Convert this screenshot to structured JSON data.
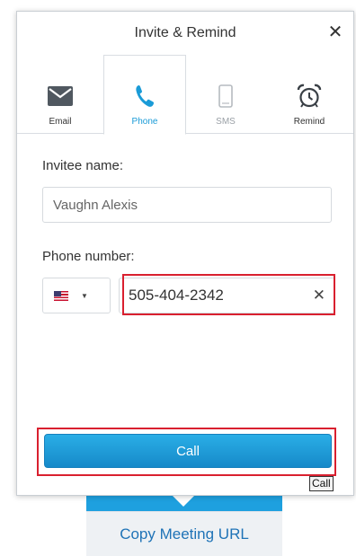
{
  "dialog": {
    "title": "Invite & Remind",
    "close_glyph": "✕"
  },
  "tabs": [
    {
      "label": "Email",
      "icon": "envelope-icon",
      "active": false
    },
    {
      "label": "Phone",
      "icon": "phone-icon",
      "active": true
    },
    {
      "label": "SMS",
      "icon": "mobile-icon",
      "active": false,
      "disabled": true
    },
    {
      "label": "Remind",
      "icon": "alarm-clock-icon",
      "active": false
    }
  ],
  "form": {
    "invitee_label": "Invitee name:",
    "invitee_value": "Vaughn Alexis",
    "phone_label": "Phone number:",
    "country_flag": "United States",
    "phone_value": "505-404-2342",
    "clear_glyph": "✕"
  },
  "actions": {
    "call_label": "Call",
    "tooltip": "Call"
  },
  "backdrop": {
    "copy_url_label": "Copy Meeting URL"
  },
  "colors": {
    "accent": "#1a9bd7",
    "highlight": "#d9202f",
    "call_button": "#1e9ad9"
  }
}
